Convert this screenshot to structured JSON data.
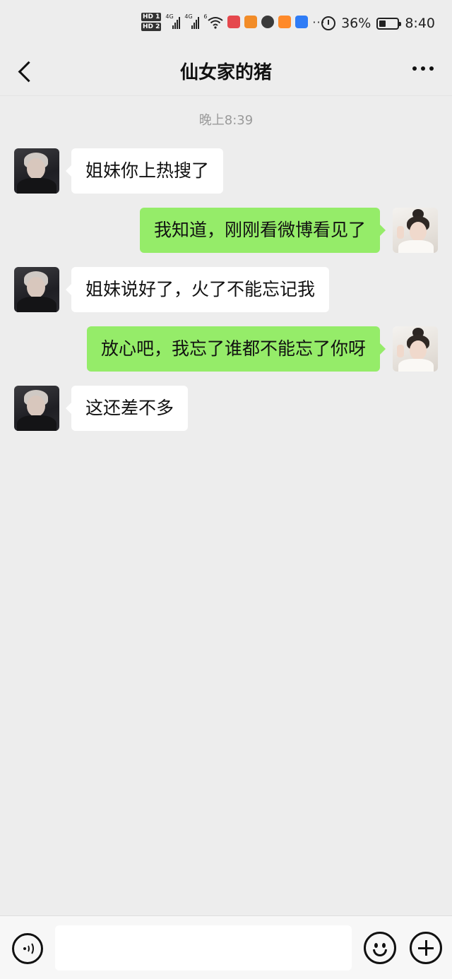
{
  "status_bar": {
    "hd1": "HD 1",
    "hd2": "HD 2",
    "sim1_gen": "4G",
    "sim2_gen": "4G",
    "wifi_gen": "6",
    "overflow": "···",
    "battery_percent": "36%",
    "battery_level": 0.36,
    "time": "8:40",
    "app_icons": [
      {
        "name": "red-app-icon",
        "color": "#e5484d"
      },
      {
        "name": "orange-video-app-icon",
        "color": "#f28c28"
      },
      {
        "name": "compass-app-icon",
        "color": "#3a3a3a"
      },
      {
        "name": "orange-app-icon",
        "color": "#ff8a2a"
      },
      {
        "name": "blue-app-icon",
        "color": "#2f7cf6"
      }
    ]
  },
  "nav": {
    "title": "仙女家的猪"
  },
  "chat": {
    "timestamp": "晚上8:39",
    "messages": [
      {
        "side": "in",
        "text": "姐妹你上热搜了"
      },
      {
        "side": "out",
        "text": "我知道，刚刚看微博看见了"
      },
      {
        "side": "in",
        "text": "姐妹说好了，火了不能忘记我"
      },
      {
        "side": "out",
        "text": "放心吧，我忘了谁都不能忘了你呀"
      },
      {
        "side": "in",
        "text": "这还差不多"
      }
    ]
  },
  "input_bar": {
    "text_value": ""
  },
  "colors": {
    "background": "#ededed",
    "outgoing_bubble": "#95ec69",
    "incoming_bubble": "#ffffff"
  }
}
